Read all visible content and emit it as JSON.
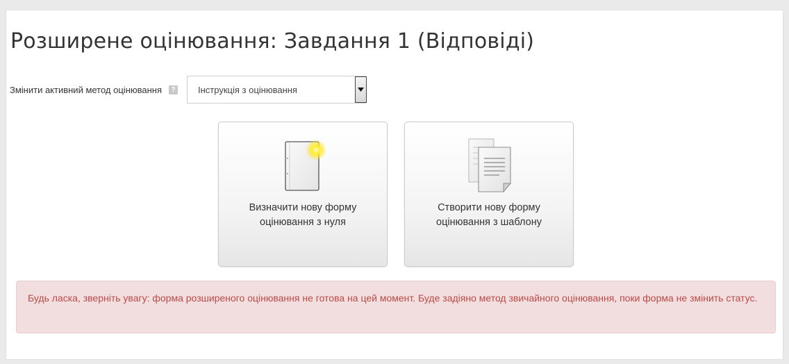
{
  "page": {
    "title": "Розширене оцінювання: Завдання 1 (Відповіді)"
  },
  "method": {
    "label": "Змінити активний метод оцінювання",
    "help_icon": "question-mark-icon",
    "selected": "Інструкція з оцінювання"
  },
  "actions": {
    "blank": {
      "icon": "blank-notebook-icon",
      "label": "Визначити нову форму оцінювання з нуля"
    },
    "template": {
      "icon": "document-copy-icon",
      "label": "Створити нову форму оцінювання з шаблону"
    }
  },
  "alert": {
    "text": "Будь ласка, зверніть увагу: форма розширеного оцінювання не готова на цей момент. Буде задіяно метод звичайного оцінювання, поки форма не змінить статус."
  },
  "colors": {
    "alert_bg": "#f2dede",
    "alert_text": "#b94a48",
    "cursor_highlight": "#ffee33"
  }
}
